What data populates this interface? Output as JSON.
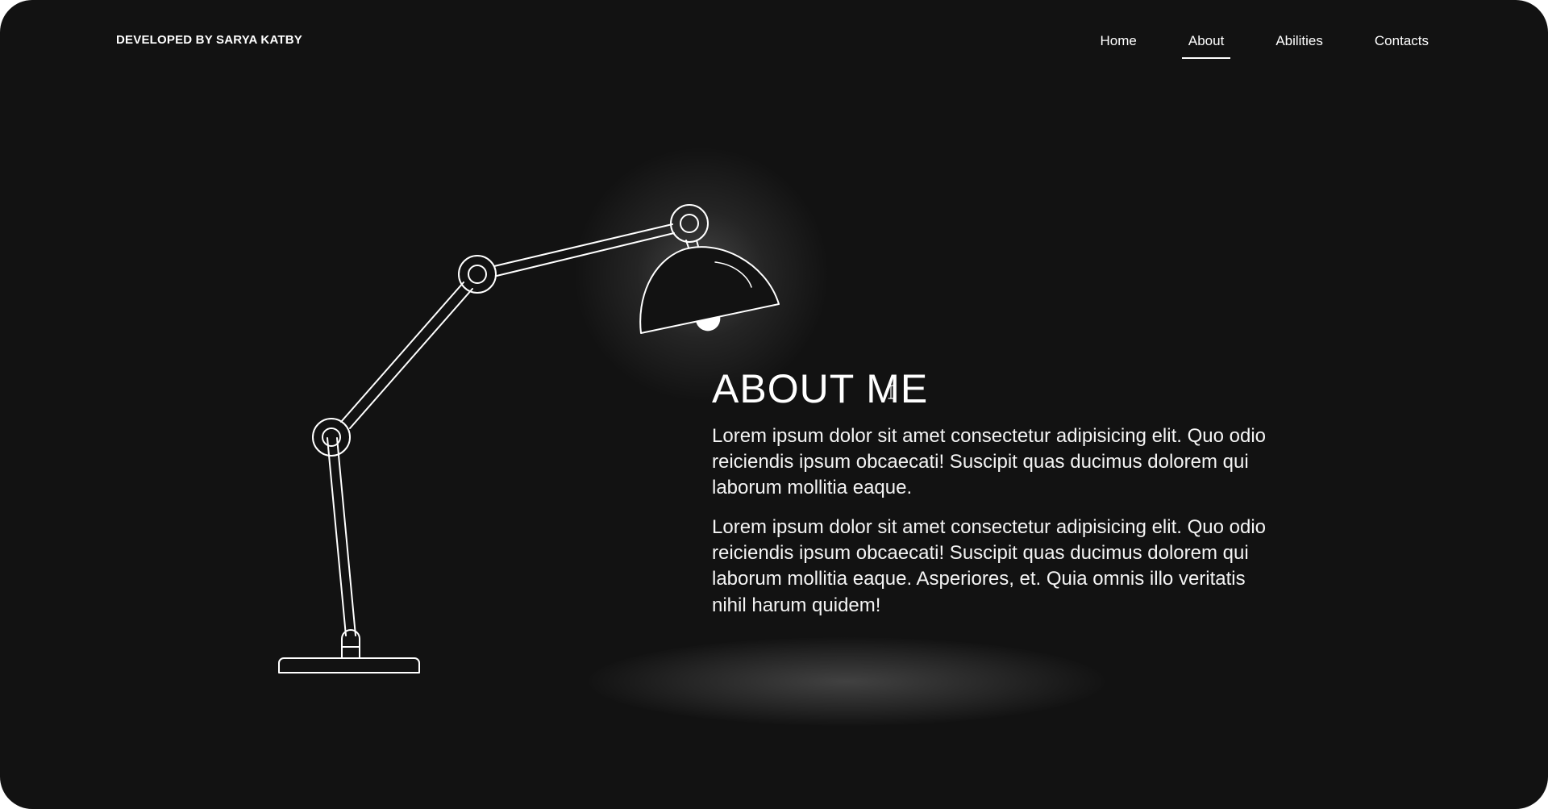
{
  "brand": "DEVELOPED BY SARYA KATBY",
  "nav": {
    "items": [
      "Home",
      "About",
      "Abilities",
      "Contacts"
    ],
    "active": "About"
  },
  "about": {
    "title": "ABOUT ME",
    "paragraphs": [
      "Lorem ipsum dolor sit amet consectetur adipisicing elit. Quo odio reiciendis ipsum obcaecati! Suscipit quas ducimus dolorem qui laborum mollitia eaque.",
      "Lorem ipsum dolor sit amet consectetur adipisicing elit. Quo odio reiciendis ipsum obcaecati! Suscipit quas ducimus dolorem qui laborum mollitia eaque. Asperiores, et. Quia omnis illo veritatis nihil harum quidem!"
    ]
  },
  "icons": {
    "lamp": "desk-lamp-icon"
  },
  "colors": {
    "background": "#121212",
    "foreground": "#ffffff"
  }
}
